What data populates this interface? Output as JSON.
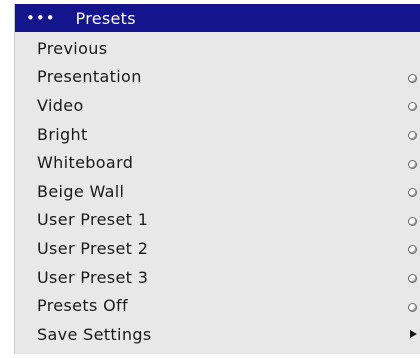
{
  "header": {
    "dots": "•••",
    "title": "Presets"
  },
  "menu": {
    "items": [
      {
        "label": "Previous",
        "control": "none"
      },
      {
        "label": "Presentation",
        "control": "radio"
      },
      {
        "label": "Video",
        "control": "radio"
      },
      {
        "label": "Bright",
        "control": "radio"
      },
      {
        "label": "Whiteboard",
        "control": "radio"
      },
      {
        "label": "Beige Wall",
        "control": "radio"
      },
      {
        "label": "User Preset 1",
        "control": "radio"
      },
      {
        "label": "User Preset 2",
        "control": "radio"
      },
      {
        "label": "User Preset 3",
        "control": "radio"
      },
      {
        "label": "Presets Off",
        "control": "radio"
      },
      {
        "label": "Save Settings",
        "control": "submenu-arrow"
      }
    ]
  },
  "colors": {
    "header_bg": "#14148c",
    "panel_bg": "#e8e8e8",
    "text": "#1a1a1a"
  }
}
